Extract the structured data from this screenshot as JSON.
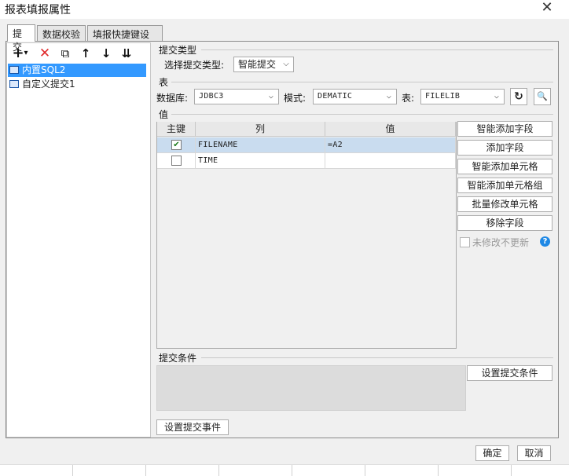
{
  "window": {
    "title": "报表填报属性",
    "close_glyph": "✕"
  },
  "tabs": [
    "提交",
    "数据校验",
    "填报快捷键设置"
  ],
  "toolbar": {
    "add": "+",
    "add_dropdown": "▾",
    "delete": "✕",
    "copy": "⧉",
    "up": "↑",
    "down": "↓",
    "sort": "⇊"
  },
  "tree": {
    "items": [
      {
        "label": "内置SQL2",
        "selected": true
      },
      {
        "label": "自定义提交1",
        "selected": false
      }
    ]
  },
  "submit_type": {
    "section": "提交类型",
    "label": "选择提交类型:",
    "value": "智能提交"
  },
  "table_section": {
    "section": "表",
    "db_label": "数据库:",
    "db_value": "JDBC3",
    "schema_label": "模式:",
    "schema_value": "DEMATIC",
    "table_label": "表:",
    "table_value": "FILELIB",
    "refresh_glyph": "↻",
    "preview_glyph": "🔍"
  },
  "values_section": {
    "section": "值",
    "headers": {
      "key": "主键",
      "column": "列",
      "value": "值"
    },
    "rows": [
      {
        "key": true,
        "column": "FILENAME",
        "value": "=A2",
        "selected": true
      },
      {
        "key": false,
        "column": "TIME",
        "value": "",
        "selected": false
      }
    ],
    "buttons": [
      "智能添加字段",
      "添加字段",
      "智能添加单元格",
      "智能添加单元格组",
      "批量修改单元格",
      "移除字段"
    ],
    "no_update_label": "未修改不更新",
    "help_glyph": "?"
  },
  "conditions": {
    "section": "提交条件",
    "button": "设置提交条件"
  },
  "event_button": "设置提交事件",
  "footer": {
    "ok": "确定",
    "cancel": "取消"
  },
  "colors": {
    "selection": "#3399ff",
    "row_selection": "#c9dcef",
    "help": "#1e88e5",
    "delete_red": "#e0282a"
  }
}
